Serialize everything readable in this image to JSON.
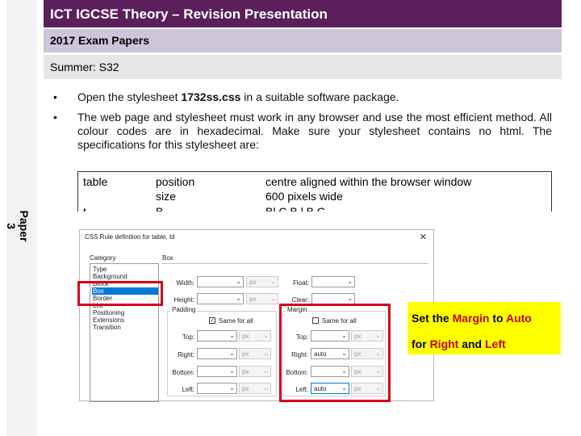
{
  "slide": {
    "title": "ICT IGCSE Theory – Revision Presentation",
    "subtitle": "2017 Exam Papers",
    "session": "Summer: S32",
    "side_label": "Paper 3"
  },
  "document": {
    "bullet1_pre": "Open the stylesheet ",
    "bullet1_bold": "1732ss.css",
    "bullet1_post": " in a suitable software package.",
    "bullet2": "The web page and stylesheet must work in any browser and use the most efficient method. All colour codes are in hexadecimal. Make sure your stylesheet contains no html. The specifications for this stylesheet are:",
    "table": {
      "selector": "table",
      "prop1": "position",
      "prop2": "size",
      "val1": "centre aligned within the browser window",
      "val2": "600 pixels wide",
      "row3_selector": "t",
      "row3_prop": "B",
      "row3_val": "Bl    C  B  l  B  C"
    }
  },
  "dialog": {
    "title": "CSS Rule definition for table, td",
    "close_icon": "close-icon",
    "category_label": "Category",
    "section_label": "Box",
    "categories": [
      "Type",
      "Background",
      "Block",
      "Box",
      "Border",
      "List",
      "Positioning",
      "Extensions",
      "Transition"
    ],
    "selected_category": "Box",
    "width_label": "Width:",
    "height_label": "Height:",
    "float_label": "Float:",
    "clear_label": "Clear:",
    "unit": "px",
    "padding_label": "Padding",
    "margin_label": "Margin",
    "same_for_all": "Same for all",
    "padding_same_checked": true,
    "margin_same_checked": false,
    "sides": [
      "Top:",
      "Right:",
      "Bottom:",
      "Left:"
    ],
    "margin_right_value": "auto",
    "margin_left_value": "auto"
  },
  "callout": {
    "line1_a": "Set the ",
    "line1_b": "Margin",
    "line1_c": " to ",
    "line1_d": "Auto",
    "line2_a": "for ",
    "line2_b": "Right",
    "line2_c": " and ",
    "line2_d": "Left"
  },
  "colors": {
    "title_bg": "#5b1f5c",
    "subtitle_bg": "#cfc5da",
    "session_bg": "#e6e6e6",
    "highlight": "#d6001c",
    "callout_bg": "#ffff00",
    "callout_red": "#c00000",
    "selection": "#0078d7"
  }
}
